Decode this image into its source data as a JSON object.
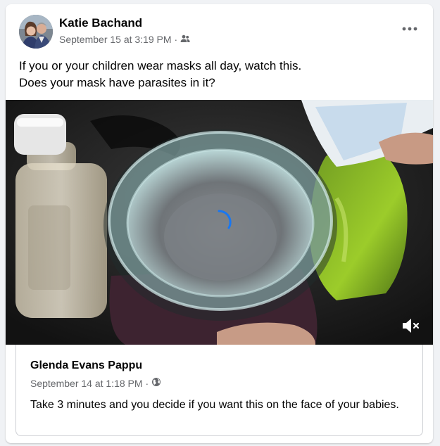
{
  "post": {
    "author": "Katie Bachand",
    "timestamp": "September 15 at 3:19 PM",
    "separator": "·",
    "audience_icon": "friends-icon",
    "more_icon": "more-options-icon",
    "caption_lines": [
      "If you or your children wear masks all day, watch this.",
      "Does your mask have parasites in it?"
    ]
  },
  "video": {
    "loading_icon": "loading-spinner-icon",
    "mute_icon": "speaker-muted-icon",
    "accent_color": "#1877f2"
  },
  "shared_post": {
    "author": "Glenda Evans Pappu",
    "timestamp": "September 14 at 1:18 PM",
    "separator": "·",
    "audience_icon": "globe-icon",
    "text": "Take 3 minutes and you decide if you want this on the face of your babies."
  }
}
